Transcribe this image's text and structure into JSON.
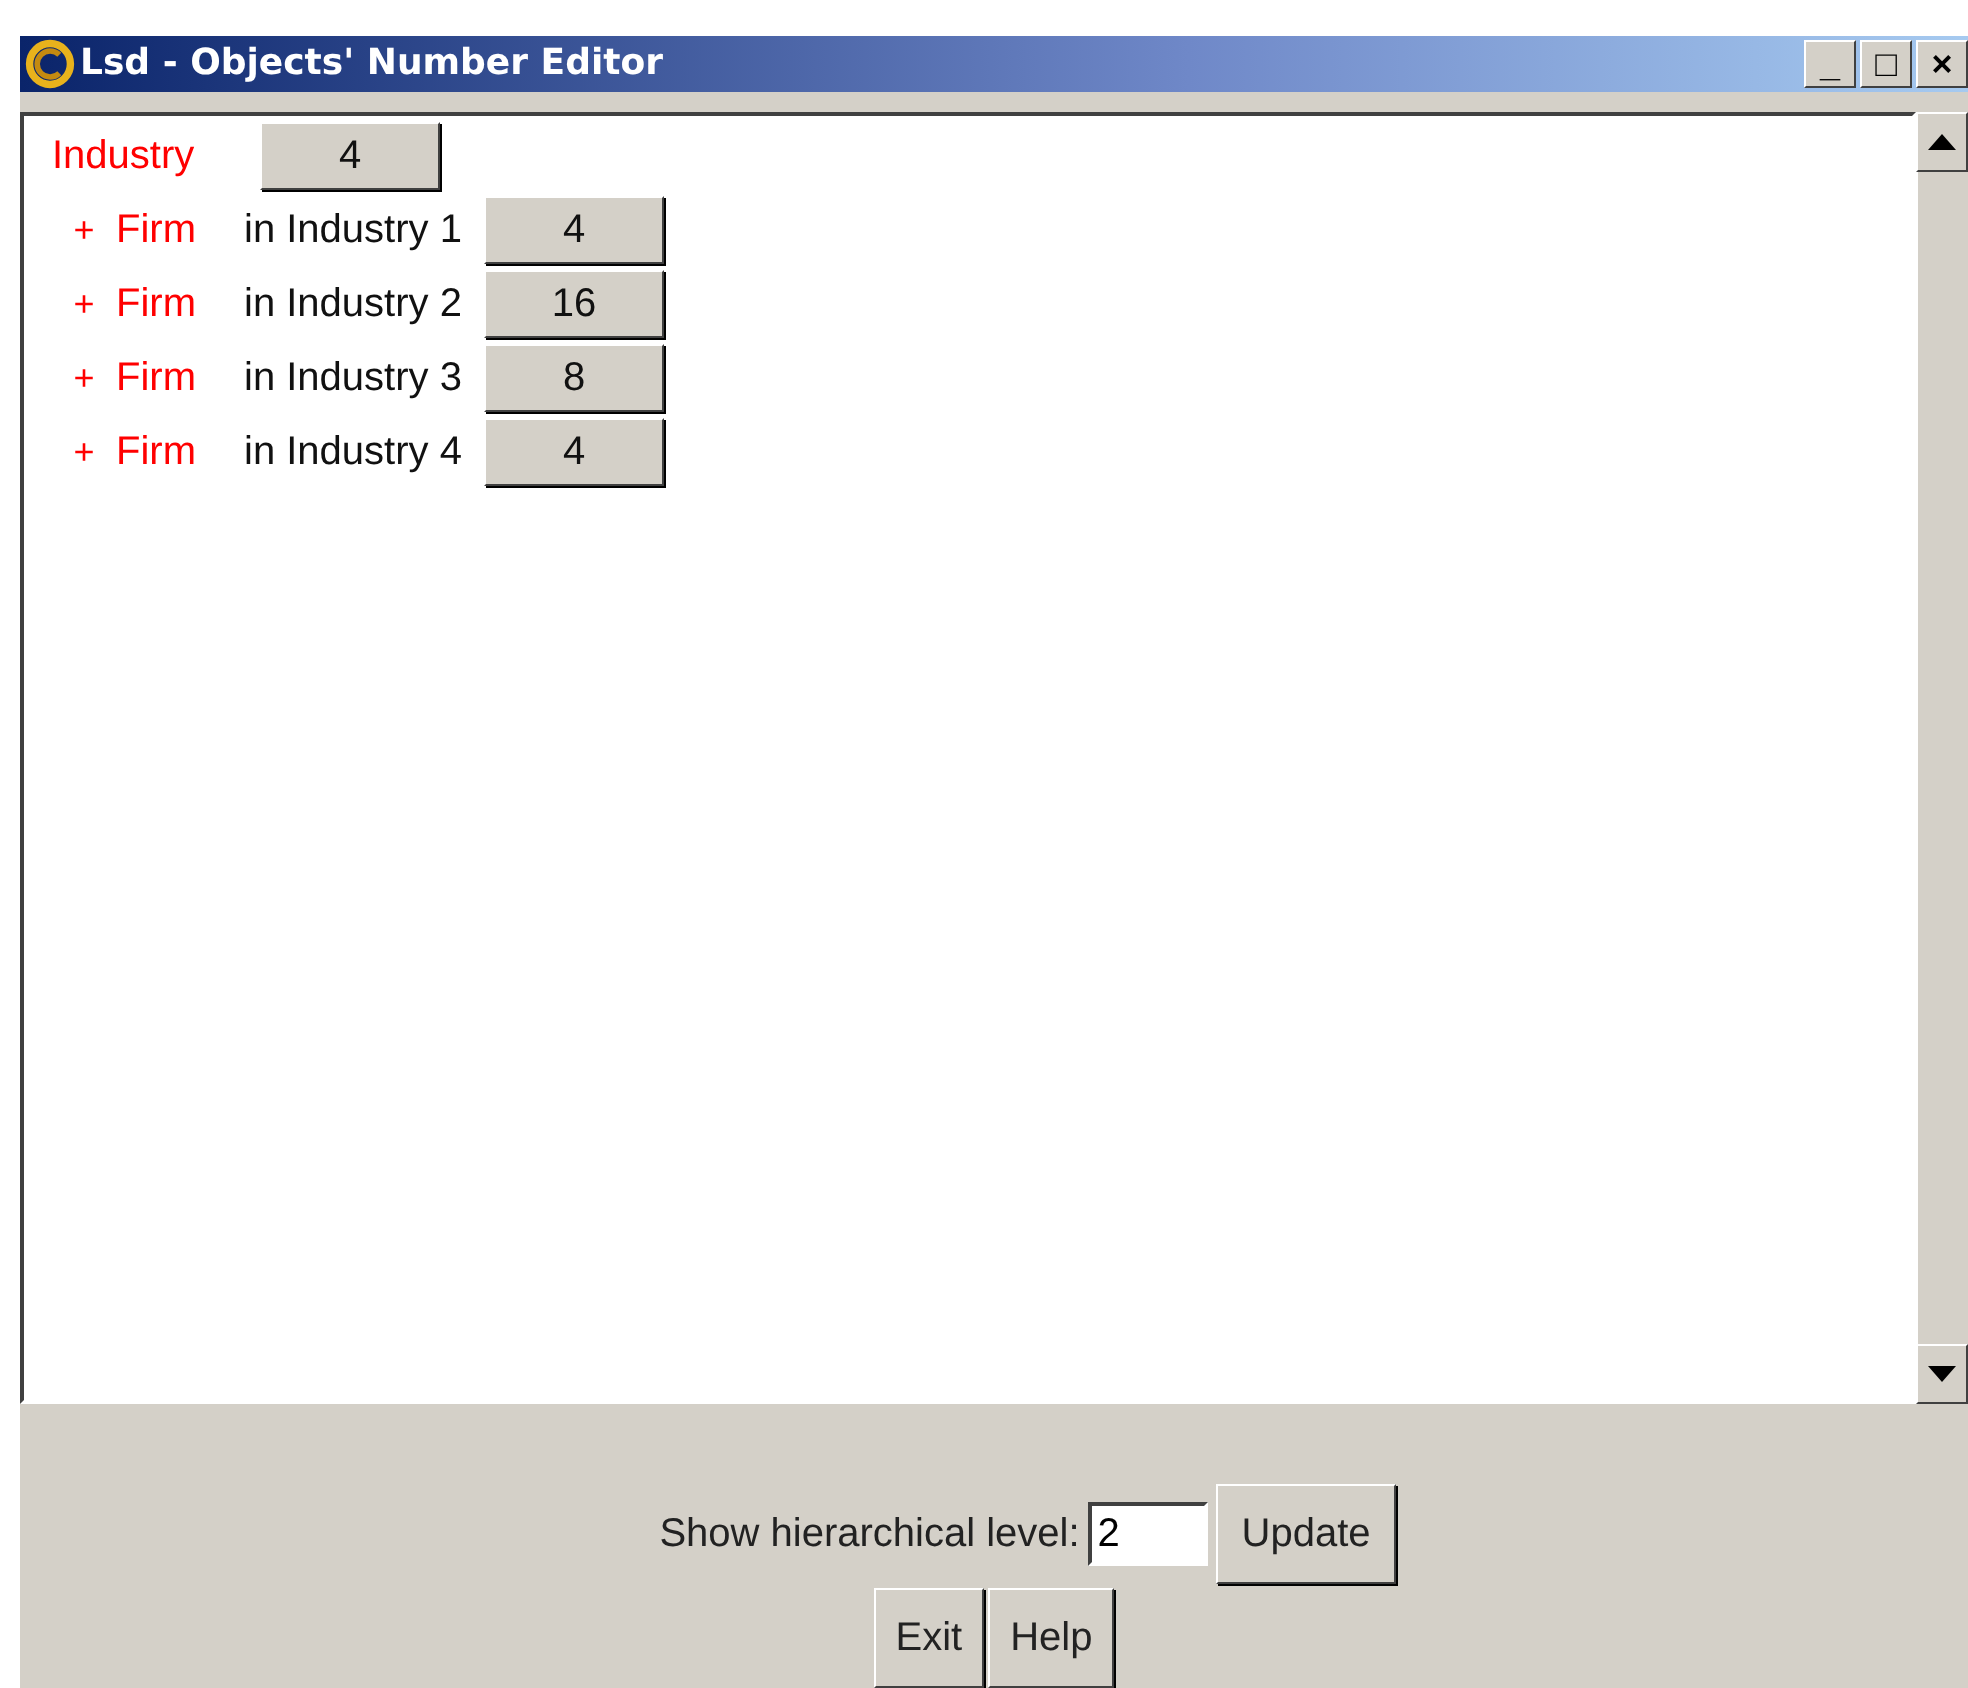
{
  "window": {
    "title": "Lsd - Objects' Number Editor",
    "controls": [
      "_",
      "□",
      "×"
    ]
  },
  "root": {
    "name": "Industry",
    "count": "4",
    "children": [
      {
        "marker": "+",
        "name": "Firm",
        "context": "in Industry 1",
        "count": "4"
      },
      {
        "marker": "+",
        "name": "Firm",
        "context": "in Industry 2",
        "count": "16"
      },
      {
        "marker": "+",
        "name": "Firm",
        "context": "in Industry 3",
        "count": "8"
      },
      {
        "marker": "+",
        "name": "Firm",
        "context": "in Industry 4",
        "count": "4"
      }
    ]
  },
  "level": {
    "label": "Show hierarchical level:",
    "value": "2",
    "button": "Update"
  },
  "buttons": [
    "Exit",
    "Help"
  ]
}
